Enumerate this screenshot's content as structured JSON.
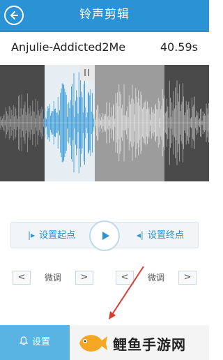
{
  "header": {
    "title": "铃声剪辑",
    "back_icon": "back-arrow-icon"
  },
  "song": {
    "name": "Anjulie-Addicted2Me",
    "duration": "40.59s"
  },
  "waveform": {
    "selection_color": "#2a93d5",
    "unselected_color": "#c8c8c8"
  },
  "controls": {
    "set_start_label": "设置起点",
    "set_end_label": "设置终点",
    "play_icon": "play-icon"
  },
  "fine_tune": {
    "left": {
      "label": "微调",
      "prev": "<",
      "next": ">"
    },
    "right": {
      "label": "微调",
      "prev": "<",
      "next": ">"
    }
  },
  "bottom": {
    "settings_label": "设置",
    "bell_icon": "bell-icon",
    "watermark_text": "鲤鱼手游网"
  },
  "colors": {
    "primary": "#2a93d5",
    "header_bg": "#2a93d5",
    "accent_red": "#d93a2f"
  }
}
